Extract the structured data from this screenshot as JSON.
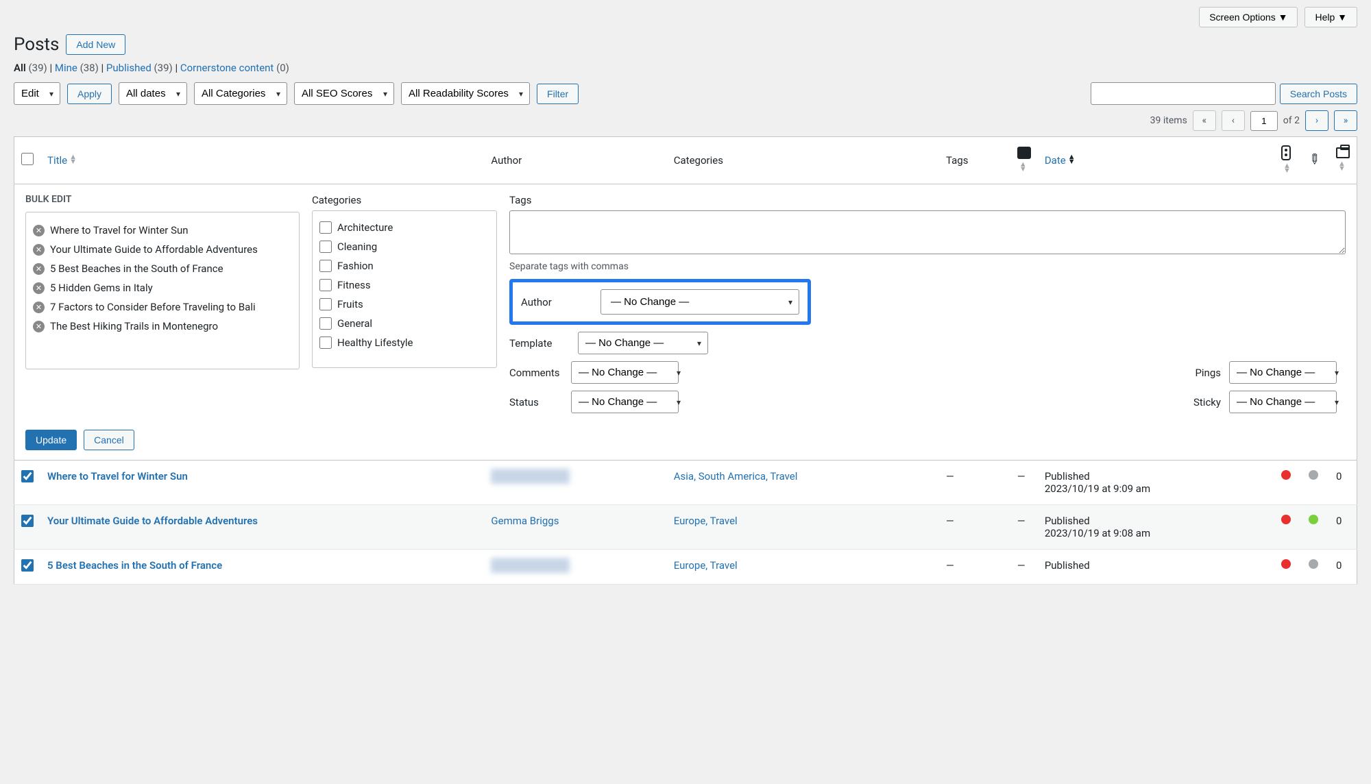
{
  "topbar": {
    "screen_options": "Screen Options",
    "help": "Help"
  },
  "page": {
    "title": "Posts",
    "add_new": "Add New"
  },
  "subsubsub": {
    "all": "All",
    "all_count": "(39)",
    "mine": "Mine",
    "mine_count": "(38)",
    "published": "Published",
    "published_count": "(39)",
    "cornerstone": "Cornerstone content",
    "cornerstone_count": "(0)",
    "sep": "  |  "
  },
  "filters": {
    "bulk_action": "Edit",
    "apply": "Apply",
    "dates": "All dates",
    "categories": "All Categories",
    "seo": "All SEO Scores",
    "readability": "All Readability Scores",
    "filter": "Filter",
    "search": "Search Posts"
  },
  "pagination": {
    "items": "39 items",
    "first": "«",
    "prev": "‹",
    "current": "1",
    "of_label": "of 2",
    "next": "›",
    "last": "»"
  },
  "columns": {
    "title": "Title",
    "author": "Author",
    "categories": "Categories",
    "tags": "Tags",
    "date": "Date"
  },
  "bulk_edit": {
    "heading": "BULK EDIT",
    "titles": [
      "Where to Travel for Winter Sun",
      "Your Ultimate Guide to Affordable Adventures",
      "5 Best Beaches in the South of France",
      "5 Hidden Gems in Italy",
      "7 Factors to Consider Before Traveling to Bali",
      "The Best Hiking Trails in Montenegro"
    ],
    "cat_label": "Categories",
    "categories": [
      "Architecture",
      "Cleaning",
      "Fashion",
      "Fitness",
      "Fruits",
      "General",
      "Healthy Lifestyle"
    ],
    "tags_label": "Tags",
    "tags_hint": "Separate tags with commas",
    "author_label": "Author",
    "template_label": "Template",
    "comments_label": "Comments",
    "pings_label": "Pings",
    "status_label": "Status",
    "sticky_label": "Sticky",
    "no_change": "— No Change —",
    "update": "Update",
    "cancel": "Cancel"
  },
  "rows": [
    {
      "title": "Where to Travel for Winter Sun",
      "author_blur": true,
      "author": "hollysantamera",
      "cats": "Asia, South America, Travel",
      "tags": "—",
      "comments": "—",
      "status": "Published",
      "date": "2023/10/19 at 9:09 am",
      "seo": "red",
      "read": "grey",
      "links": "0"
    },
    {
      "title": "Your Ultimate Guide to Affordable Adventures",
      "author_blur": false,
      "author": "Gemma Briggs",
      "cats": "Europe, Travel",
      "tags": "—",
      "comments": "—",
      "status": "Published",
      "date": "2023/10/19 at 9:08 am",
      "seo": "red",
      "read": "green",
      "links": "0"
    },
    {
      "title": "5 Best Beaches in the South of France",
      "author_blur": true,
      "author": "hollysantamera",
      "cats": "Europe, Travel",
      "tags": "—",
      "comments": "—",
      "status": "Published",
      "date": "",
      "seo": "red",
      "read": "grey",
      "links": "0"
    }
  ]
}
